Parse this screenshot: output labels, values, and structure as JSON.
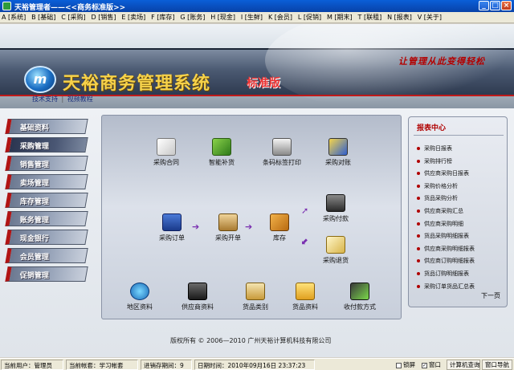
{
  "window": {
    "title": "天裕管理者——<<商务标准版>>",
    "buttons": {
      "minimize": "_",
      "maximize": "□",
      "close": "×"
    }
  },
  "menubar": [
    "A [系统]",
    "B [基础]",
    "C [采购]",
    "D [销售]",
    "E [卖场]",
    "F [库存]",
    "G [账务]",
    "H [现金]",
    "I [生鲜]",
    "K [会员]",
    "L [促销]",
    "M [期末]",
    "T [联租]",
    "N [报表]",
    "V [关于]"
  ],
  "header": {
    "brand": "天裕商务管理系统",
    "edition": "标准版",
    "slogan": "让管理从此变得轻松",
    "logo_text": "m"
  },
  "support": {
    "tech_support": "技术支持",
    "separator": "|",
    "video_tutorial": "视频教程"
  },
  "nav": {
    "items": [
      {
        "label": "基础资料",
        "active": false
      },
      {
        "label": "采购管理",
        "active": true
      },
      {
        "label": "销售管理",
        "active": false
      },
      {
        "label": "卖场管理",
        "active": false
      },
      {
        "label": "库存管理",
        "active": false
      },
      {
        "label": "账务管理",
        "active": false
      },
      {
        "label": "现金银行",
        "active": false
      },
      {
        "label": "会员管理",
        "active": false
      },
      {
        "label": "促销管理",
        "active": false
      }
    ]
  },
  "center": {
    "row1": [
      "采购合同",
      "智能补货",
      "条码标签打印",
      "采购对账"
    ],
    "flow": {
      "order": "采购订单",
      "receipt": "采购开单",
      "stock": "库存",
      "payment": "采购付款",
      "return": "采购退货"
    },
    "row3": [
      "地区资料",
      "供应商资料",
      "货品类别",
      "货品资料",
      "收付款方式"
    ]
  },
  "report": {
    "title": "报表中心",
    "items": [
      "采购日报表",
      "采购排行榜",
      "供应商采购日报表",
      "采购价格分析",
      "货品采购分析",
      "供应商采购汇总",
      "供应商采购明细",
      "货品采购明细报表",
      "供应商采购明细报表",
      "供应商订购明细报表",
      "货品订购明细报表",
      "采购订单货品汇总表"
    ],
    "next": "下一页"
  },
  "copyright": "版权所有 © 2006—2010 广州天裕计算机科技有限公司",
  "status": {
    "user": "当前用户：管理员",
    "account": "当前帐套：学习帐套",
    "period": "进销存期间：9",
    "date": "日期时间：2010年09月16日  23:37:23",
    "check1": "锁屏",
    "check2": "窗口",
    "btn_calc": "计算机查询",
    "btn_window": "窗口导航"
  },
  "colors": {
    "accent_red": "#b11414",
    "brand_gold": "#f6d24a",
    "titlebar_blue": "#0a5fd8"
  }
}
